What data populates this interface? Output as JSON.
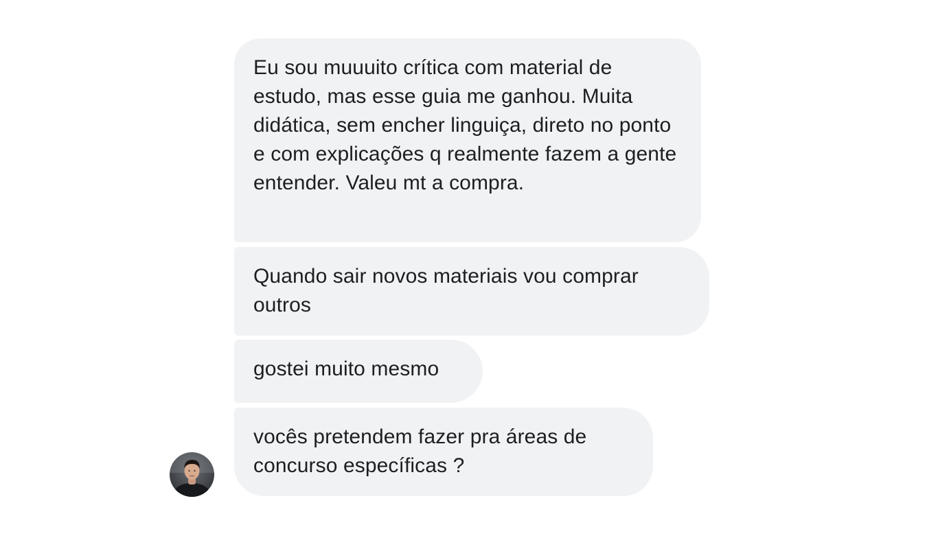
{
  "conversation": {
    "messages": [
      {
        "text": "Eu sou muuuito crítica com material de estudo, mas esse guia me ganhou. Muita didática, sem encher linguiça, direto no ponto e com explicações q realmente fazem a gente entender. Valeu mt a compra."
      },
      {
        "text": "Quando sair novos materiais vou comprar outros"
      },
      {
        "text": "gostei muito mesmo"
      },
      {
        "text": "vocês pretendem fazer pra áreas de concurso específicas ?"
      }
    ],
    "sender": {
      "avatar_icon": "user-photo-avatar"
    },
    "colors": {
      "bubble_background": "#f1f2f4",
      "text": "#1c1e21",
      "page_background": "#ffffff"
    }
  }
}
